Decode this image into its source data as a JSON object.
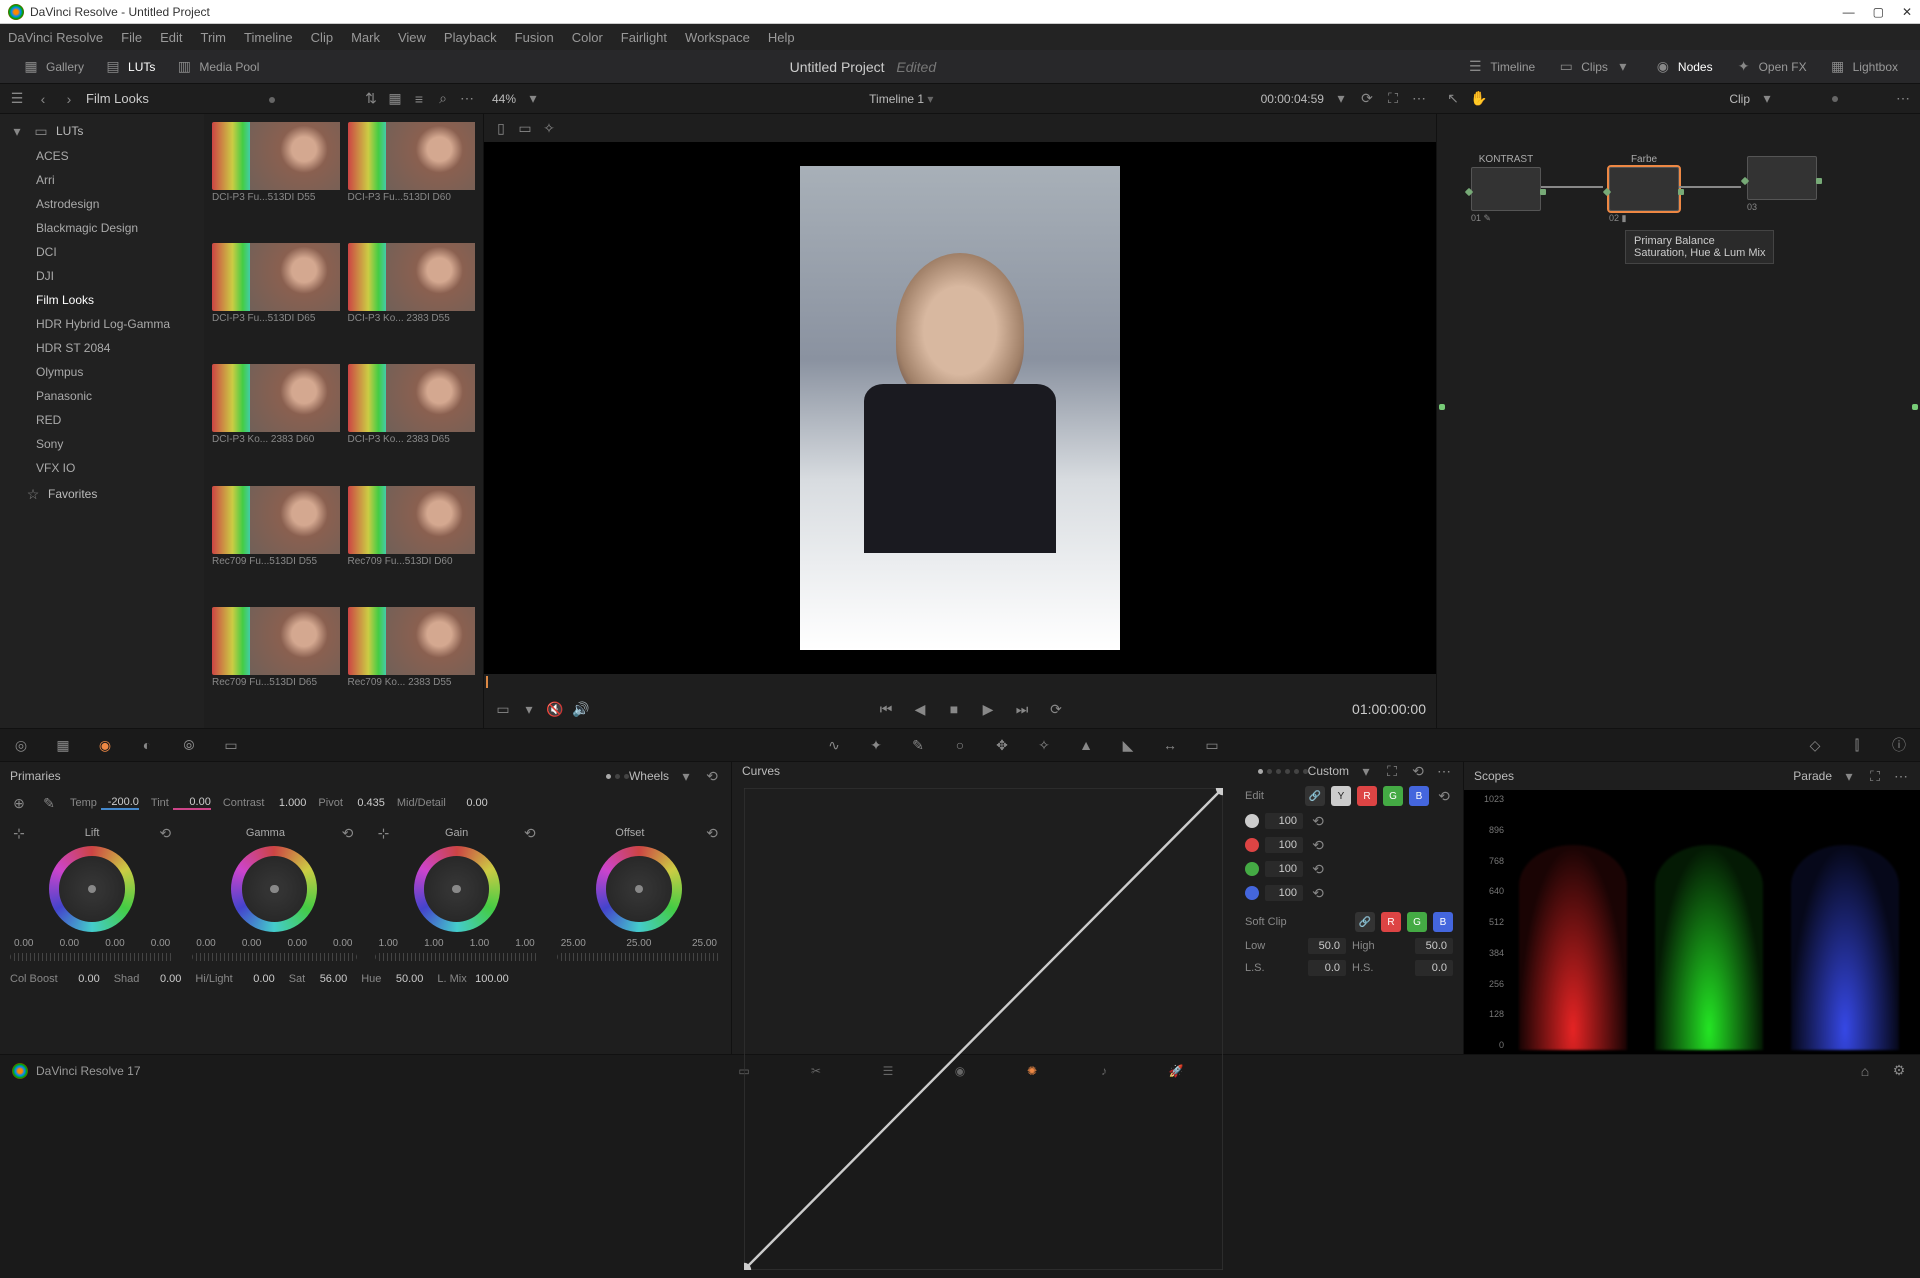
{
  "window": {
    "title": "DaVinci Resolve - Untitled Project"
  },
  "menubar": [
    "DaVinci Resolve",
    "File",
    "Edit",
    "Trim",
    "Timeline",
    "Clip",
    "Mark",
    "View",
    "Playback",
    "Fusion",
    "Color",
    "Fairlight",
    "Workspace",
    "Help"
  ],
  "toolbar": {
    "gallery": "Gallery",
    "luts": "LUTs",
    "mediapool": "Media Pool",
    "project": "Untitled Project",
    "edited": "Edited",
    "timeline": "Timeline",
    "clips": "Clips",
    "nodes": "Nodes",
    "openfx": "Open FX",
    "lightbox": "Lightbox"
  },
  "subtoolbar": {
    "folder": "Film Looks",
    "zoom": "44%",
    "timeline_name": "Timeline 1",
    "timecode": "00:00:04:59",
    "right_mode": "Clip"
  },
  "lut_tree": {
    "root": "LUTs",
    "items": [
      "ACES",
      "Arri",
      "Astrodesign",
      "Blackmagic Design",
      "DCI",
      "DJI",
      "Film Looks",
      "HDR Hybrid Log-Gamma",
      "HDR ST 2084",
      "Olympus",
      "Panasonic",
      "RED",
      "Sony",
      "VFX IO"
    ],
    "favorites": "Favorites",
    "selected_index": 6
  },
  "lut_thumbs": [
    "DCI-P3 Fu...513DI D55",
    "DCI-P3 Fu...513DI D60",
    "DCI-P3 Fu...513DI D65",
    "DCI-P3 Ko... 2383 D55",
    "DCI-P3 Ko... 2383 D60",
    "DCI-P3 Ko... 2383 D65",
    "Rec709 Fu...513DI D55",
    "Rec709 Fu...513DI D60",
    "Rec709 Fu...513DI D65",
    "Rec709 Ko... 2383 D55"
  ],
  "transport": {
    "timecode": "01:00:00:00"
  },
  "nodes": {
    "labels": [
      "KONTRAST",
      "Farbe",
      ""
    ],
    "nums": [
      "01",
      "02",
      "03"
    ],
    "tooltip": {
      "line1": "Primary Balance",
      "line2": "Saturation, Hue & Lum Mix"
    }
  },
  "primaries": {
    "title": "Primaries",
    "mode": "Wheels",
    "temp": {
      "label": "Temp",
      "value": "-200.0"
    },
    "tint": {
      "label": "Tint",
      "value": "0.00"
    },
    "contrast": {
      "label": "Contrast",
      "value": "1.000"
    },
    "pivot": {
      "label": "Pivot",
      "value": "0.435"
    },
    "md": {
      "label": "Mid/Detail",
      "value": "0.00"
    },
    "wheels": [
      {
        "name": "Lift",
        "vals": [
          "0.00",
          "0.00",
          "0.00",
          "0.00"
        ]
      },
      {
        "name": "Gamma",
        "vals": [
          "0.00",
          "0.00",
          "0.00",
          "0.00"
        ]
      },
      {
        "name": "Gain",
        "vals": [
          "1.00",
          "1.00",
          "1.00",
          "1.00"
        ]
      },
      {
        "name": "Offset",
        "vals": [
          "25.00",
          "25.00",
          "25.00"
        ]
      }
    ],
    "row3": {
      "colboost": {
        "label": "Col Boost",
        "value": "0.00"
      },
      "shad": {
        "label": "Shad",
        "value": "0.00"
      },
      "hilight": {
        "label": "Hi/Light",
        "value": "0.00"
      },
      "sat": {
        "label": "Sat",
        "value": "56.00"
      },
      "hue": {
        "label": "Hue",
        "value": "50.00"
      },
      "lmix": {
        "label": "L. Mix",
        "value": "100.00"
      }
    }
  },
  "curves": {
    "title": "Curves",
    "mode": "Custom",
    "edit_label": "Edit",
    "channel_vals": [
      "100",
      "100",
      "100",
      "100"
    ],
    "softclip": {
      "label": "Soft Clip",
      "low_l": "Low",
      "low": "50.0",
      "high_l": "High",
      "high": "50.0",
      "ls_l": "L.S.",
      "ls": "0.0",
      "hs_l": "H.S.",
      "hs": "0.0"
    }
  },
  "scopes": {
    "title": "Scopes",
    "mode": "Parade",
    "axis": [
      "1023",
      "896",
      "768",
      "640",
      "512",
      "384",
      "256",
      "128",
      "0"
    ]
  },
  "footer": {
    "version": "DaVinci Resolve 17"
  }
}
